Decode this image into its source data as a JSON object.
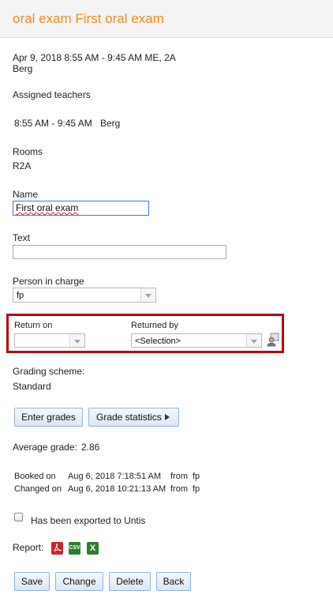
{
  "header": {
    "title": "oral exam First oral exam"
  },
  "lesson": {
    "datetime": "Apr 9, 2018 8:55 AM - 9:45 AM ME, 2A",
    "teacher": "Berg"
  },
  "assigned_teachers": {
    "label": "Assigned teachers",
    "time": "8:55 AM - 9:45 AM",
    "teacher": "Berg"
  },
  "rooms": {
    "label": "Rooms",
    "value": "R2A"
  },
  "name": {
    "label": "Name",
    "value": "First oral exam"
  },
  "text": {
    "label": "Text",
    "value": ""
  },
  "person_in_charge": {
    "label": "Person in charge",
    "value": "fp"
  },
  "return_on": {
    "label": "Return on",
    "value": ""
  },
  "returned_by": {
    "label": "Returned by",
    "value": "<Selection>"
  },
  "grading": {
    "label": "Grading scheme:",
    "value": "Standard"
  },
  "buttons": {
    "enter_grades": "Enter grades",
    "grade_statistics": "Grade statistics"
  },
  "average": {
    "label": "Average grade:",
    "value": "2.86"
  },
  "booked": {
    "label": "Booked on",
    "date": "Aug 6, 2018 7:18:51 AM",
    "from_label": "from",
    "user": "fp"
  },
  "changed": {
    "label": "Changed on",
    "date": "Aug 6, 2018 10:21:13 AM",
    "from_label": "from",
    "user": "fp"
  },
  "exported": {
    "label": "Has been exported to Untis",
    "checked": false
  },
  "report": {
    "label": "Report:",
    "icons": [
      "pdf-icon",
      "csv-icon",
      "excel-icon"
    ],
    "csv_text": "CSV",
    "xls_text": "X"
  },
  "actions": {
    "save": "Save",
    "change": "Change",
    "delete": "Delete",
    "back": "Back"
  },
  "colors": {
    "title": "#f28c1e",
    "highlight_box": "#b20c0c"
  }
}
